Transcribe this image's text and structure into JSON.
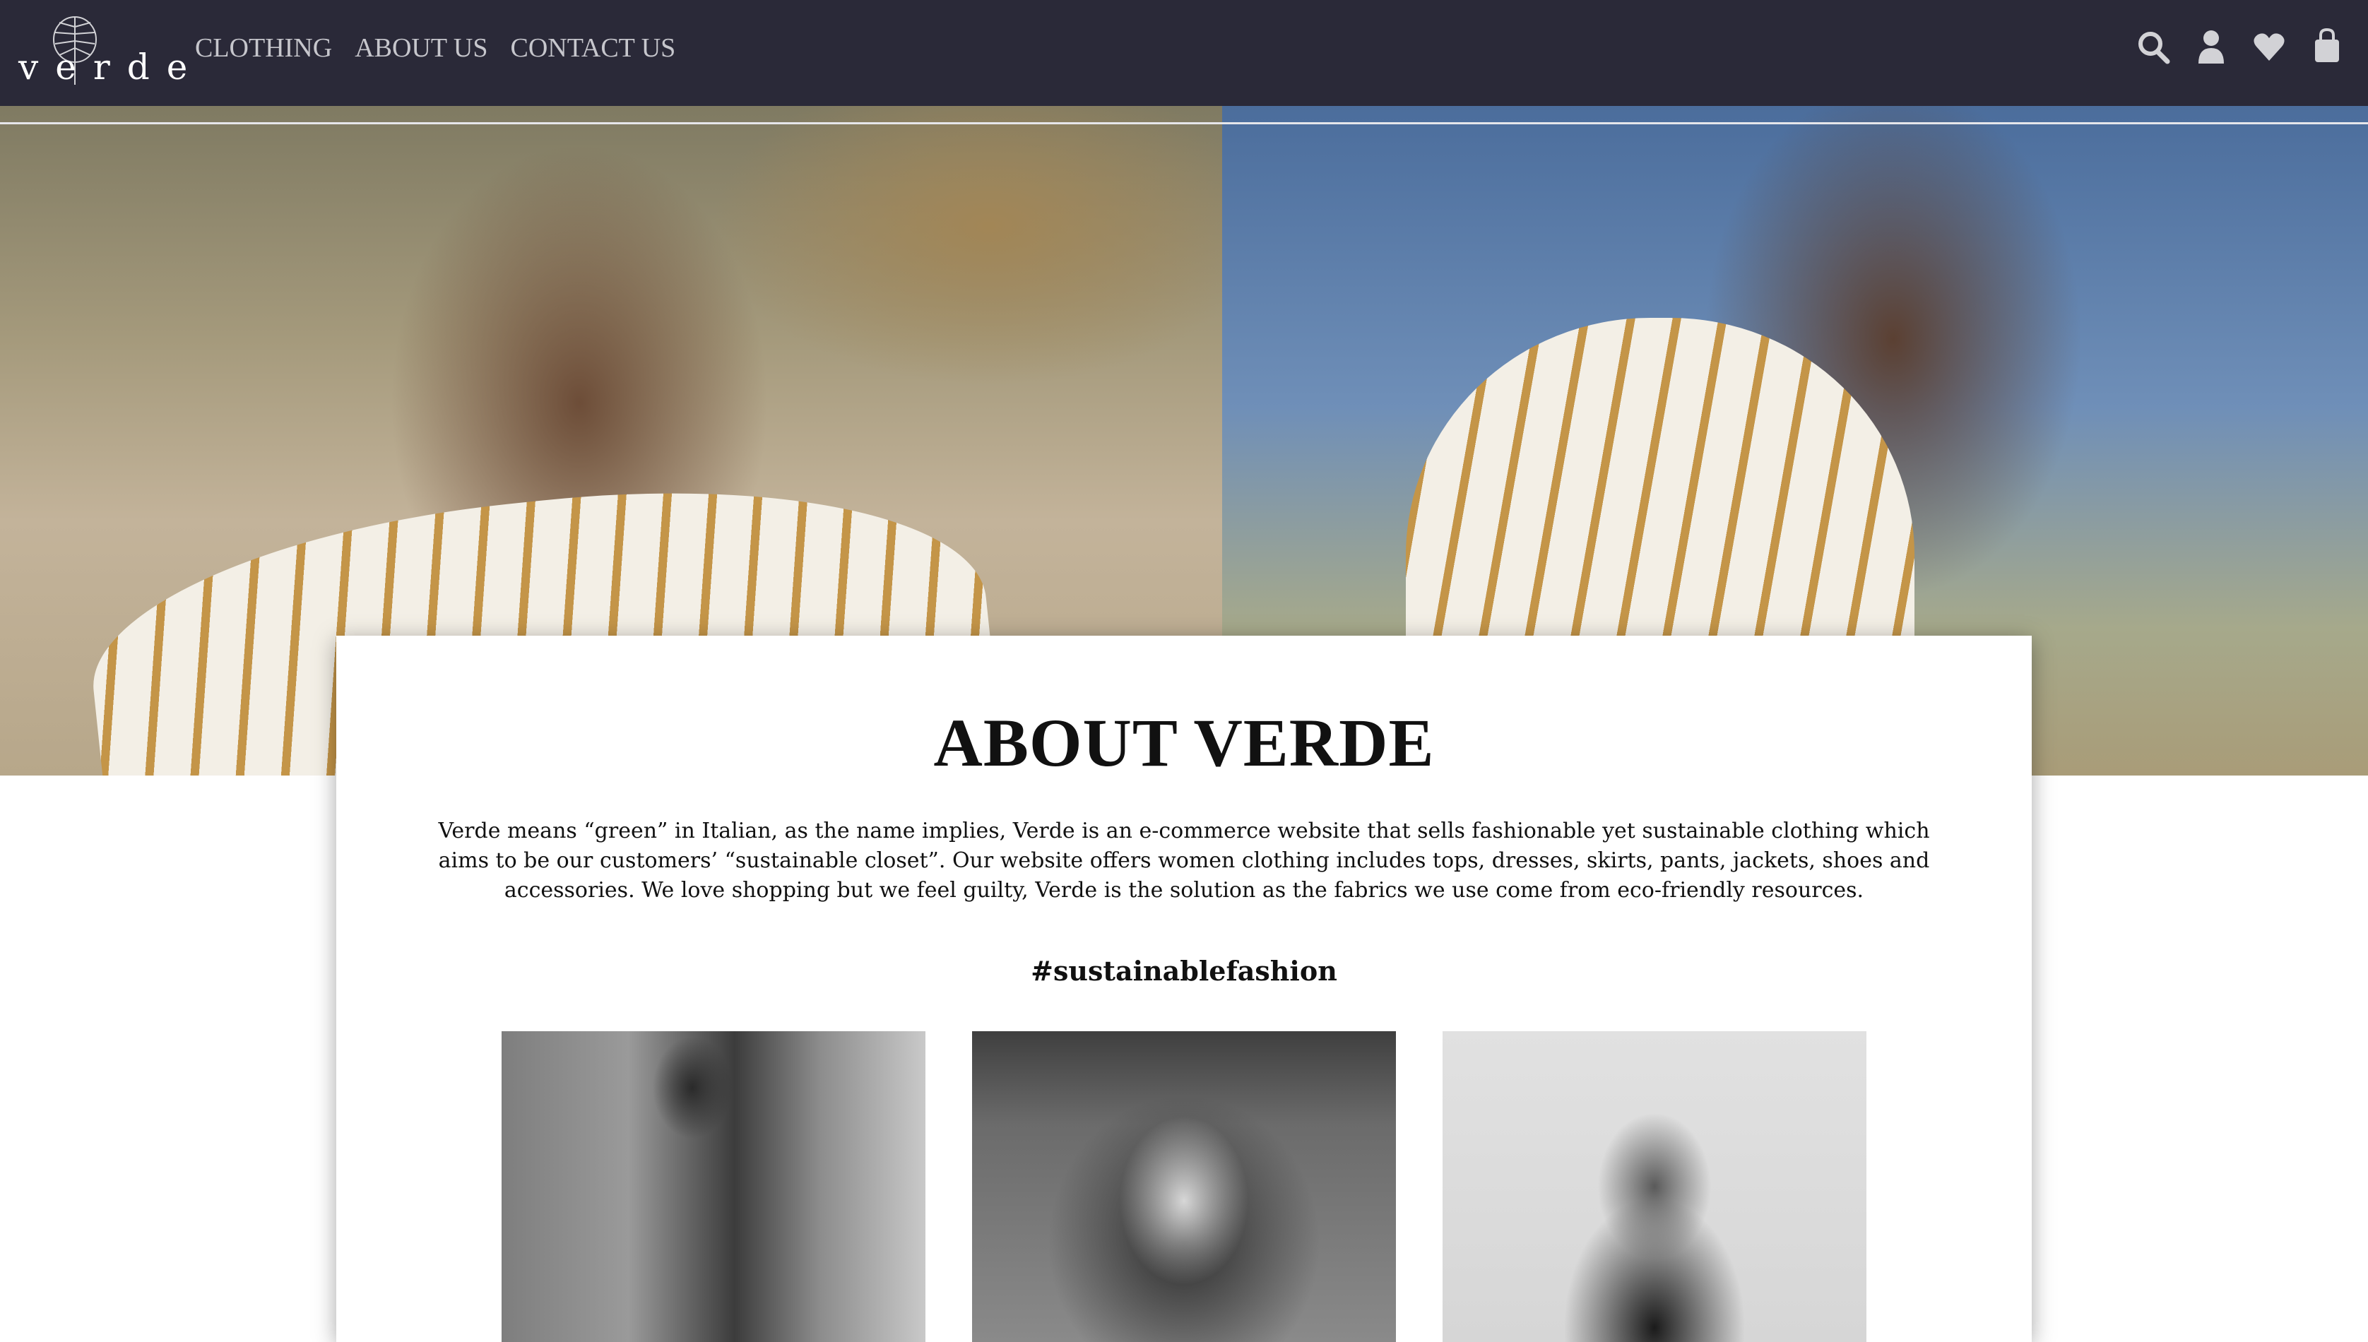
{
  "brand": {
    "logo_text": "verde",
    "logo_icon": "monstera-leaf-icon"
  },
  "nav": {
    "links": [
      {
        "label": "CLOTHING"
      },
      {
        "label": "ABOUT US"
      },
      {
        "label": "CONTACT US"
      }
    ],
    "icons": [
      "search-icon",
      "user-icon",
      "heart-icon",
      "shopping-bag-icon"
    ]
  },
  "hero": {
    "images": [
      "model-beach-grass-photo-left",
      "model-beach-grass-photo-right"
    ]
  },
  "about": {
    "title": "ABOUT VERDE",
    "description": "Verde means “green” in Italian, as the name implies, Verde is an e-commerce website that sells fashionable yet sustainable clothing which aims to be our customers’ “sustainable closet”. Our website offers women clothing includes tops, dresses, skirts, pants, jackets, shoes and accessories. We love shopping but we feel guilty, Verde is the solution as the fabrics we use come from eco-friendly resources.",
    "hashtag": "#sustainablefashion"
  },
  "team": {
    "photos": [
      "team-member-photo-1",
      "team-member-photo-2",
      "team-member-photo-3"
    ]
  },
  "colors": {
    "navbar_bg": "#2a2938",
    "nav_text": "#c6c6cc",
    "icon": "#d2d2d6",
    "stripe_accent": "#c49548"
  }
}
